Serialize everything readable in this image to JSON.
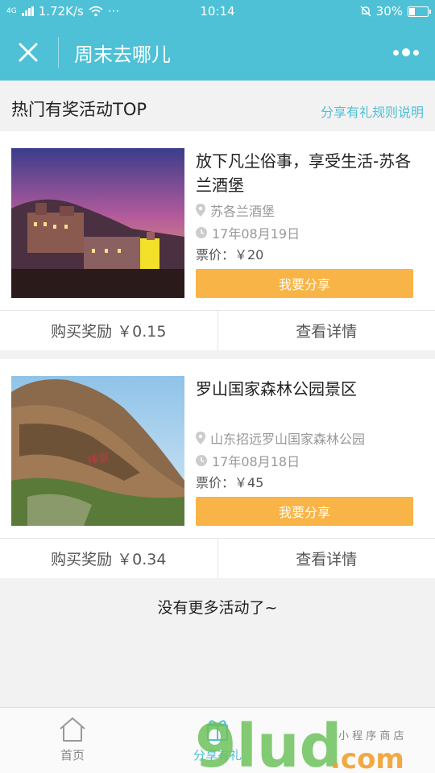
{
  "status_bar": {
    "network": "4G",
    "speed": "1.72K/s",
    "more": "···",
    "time": "10:14",
    "battery": "30%",
    "battery_level": 0.3
  },
  "header": {
    "title": "周末去哪儿",
    "close_icon": "close-icon",
    "more_icon": "more-dots-icon"
  },
  "section": {
    "title": "热门有奖活动TOP",
    "rules_link": "分享有礼规则说明"
  },
  "activities": [
    {
      "title": "放下凡尘俗事，享受生活-苏各兰酒堡",
      "location": "苏各兰酒堡",
      "date": "17年08月19日",
      "price": "票价：￥20",
      "share_label": "我要分享",
      "reward": "购买奖励 ￥0.15",
      "detail_label": "查看详情"
    },
    {
      "title": "罗山国家森林公园景区",
      "location": "山东招远罗山国家森林公园",
      "date": "17年08月18日",
      "price": "票价：￥45",
      "share_label": "我要分享",
      "reward": "购买奖励 ￥0.34",
      "detail_label": "查看详情"
    }
  ],
  "no_more_text": "没有更多活动了~",
  "bottom_nav": {
    "items": [
      {
        "label": "首页",
        "icon": "home-icon"
      },
      {
        "label": "分享有礼",
        "icon": "gift-icon",
        "active": true
      }
    ]
  },
  "watermark": "9lud.com",
  "colors": {
    "primary": "#4ec1d6",
    "share_button": "#f8b446",
    "background": "#f2f2f2"
  }
}
